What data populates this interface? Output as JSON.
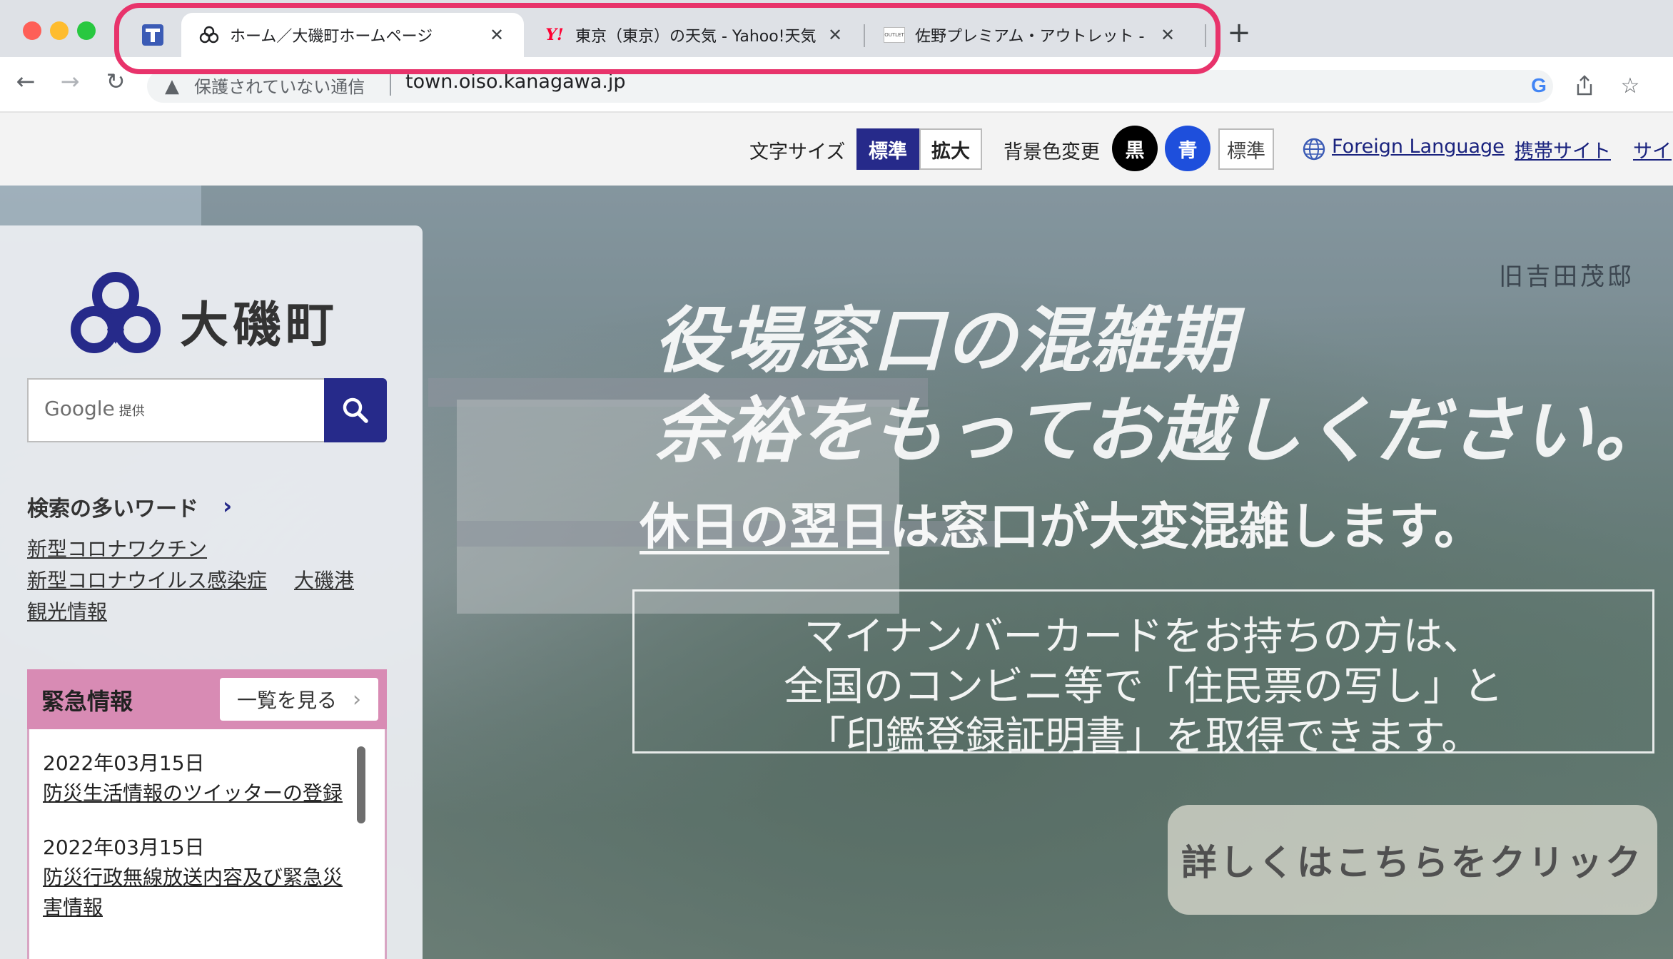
{
  "browser": {
    "tabs": [
      {
        "title": "ホーム／大磯町ホームページ",
        "favicon": "cloud-outline-icon",
        "active": true
      },
      {
        "title": "東京（東京）の天気 - Yahoo!天気",
        "favicon": "yahoo-icon",
        "active": false
      },
      {
        "title": "佐野プレミアム・アウトレット - P",
        "favicon": "outlet-icon",
        "active": false
      }
    ],
    "security_label": "保護されていない通信",
    "url": "town.oiso.kanagawa.jp",
    "highlight_color": "#e8336b"
  },
  "utility": {
    "font_size_label": "文字サイズ",
    "font_size_standard": "標準",
    "font_size_large": "拡大",
    "bg_label": "背景色変更",
    "bg_black": "黒",
    "bg_blue": "青",
    "bg_standard": "標準",
    "foreign_language": "Foreign Language",
    "mobile_site": "携帯サイト",
    "site_cutoff": "サイ"
  },
  "sidebar": {
    "logo_text": "大磯町",
    "search_placeholder": "Google",
    "search_provider_suffix": "提供",
    "keywords_title": "検索の多いワード",
    "keywords": [
      "新型コロナワクチン",
      "新型コロナウイルス感染症",
      "大磯港",
      "観光情報"
    ],
    "emergency": {
      "title": "緊急情報",
      "view_all": "一覧を見る",
      "items": [
        {
          "date": "2022年03月15日",
          "text": "防災生活情報のツイッターの登録"
        },
        {
          "date": "2022年03月15日",
          "text_line1": "防災行政無線放送内容及び緊急災",
          "text_line2": "害情報"
        }
      ]
    }
  },
  "hero": {
    "caption": "旧吉田茂邸",
    "headline1": "役場窓口の混雑期",
    "headline2": "余裕をもってお越しください。",
    "subhead_underlined": "休日の翌日",
    "subhead_rest": "は窓口が大変混雑します。",
    "box_line1": "マイナンバーカードをお持ちの方は、",
    "box_line2": "全国のコンビニ等で「住民票の写し」と",
    "box_line3": "「印鑑登録証明書」を取得できます。",
    "cta": "詳しくはこちらをクリック"
  },
  "colors": {
    "brand_navy": "#262a8a",
    "emergency_pink": "#d88bb4",
    "bg_blue": "#1e4fdc"
  }
}
